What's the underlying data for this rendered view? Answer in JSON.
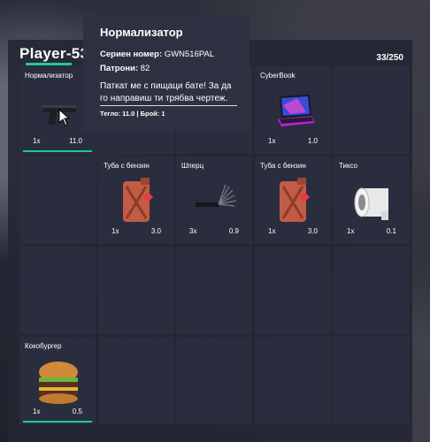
{
  "player": {
    "name": "Player-53",
    "capacity": "33/250"
  },
  "tooltip": {
    "title": "Нормализатор",
    "serial_label": "Сериен номер:",
    "serial_value": "GWN516PAL",
    "ammo_label": "Патрони:",
    "ammo_value": "82",
    "description": "Паткат ме с пищаци бате! За да го направиш ти трябва чертеж.",
    "footer": "Тегло: 11.0 | Брой: 1"
  },
  "slots": [
    {
      "label": "Нормализатор",
      "count": "1x",
      "weight": "11.0",
      "icon": "pistol-icon",
      "equipped": true
    },
    {
      "label": "",
      "count": "",
      "weight": "",
      "icon": "",
      "equipped": false
    },
    {
      "label": "",
      "count": "",
      "weight": "",
      "icon": "",
      "equipped": false
    },
    {
      "label": "CyberBook",
      "count": "1x",
      "weight": "1.0",
      "icon": "laptop-icon",
      "equipped": false
    },
    {
      "label": "",
      "count": "",
      "weight": "",
      "icon": "",
      "equipped": false
    },
    {
      "label": "",
      "count": "",
      "weight": "",
      "icon": "",
      "equipped": false
    },
    {
      "label": "Туба с бензин",
      "count": "1x",
      "weight": "3.0",
      "icon": "jerrycan-icon",
      "equipped": false
    },
    {
      "label": "Шперц",
      "count": "3x",
      "weight": "0.9",
      "icon": "lockpick-icon",
      "equipped": false
    },
    {
      "label": "Туба с бензин",
      "count": "1x",
      "weight": "3.0",
      "icon": "jerrycan-icon",
      "equipped": false
    },
    {
      "label": "Тиксо",
      "count": "1x",
      "weight": "0.1",
      "icon": "tape-icon",
      "equipped": false
    },
    {
      "label": "",
      "count": "",
      "weight": "",
      "icon": "",
      "equipped": false
    },
    {
      "label": "",
      "count": "",
      "weight": "",
      "icon": "",
      "equipped": false
    },
    {
      "label": "",
      "count": "",
      "weight": "",
      "icon": "",
      "equipped": false
    },
    {
      "label": "",
      "count": "",
      "weight": "",
      "icon": "",
      "equipped": false
    },
    {
      "label": "",
      "count": "",
      "weight": "",
      "icon": "",
      "equipped": false
    },
    {
      "label": "Кокобургер",
      "count": "1x",
      "weight": "0.5",
      "icon": "burger-icon",
      "equipped": true
    },
    {
      "label": "",
      "count": "",
      "weight": "",
      "icon": "",
      "equipped": false
    },
    {
      "label": "",
      "count": "",
      "weight": "",
      "icon": "",
      "equipped": false
    },
    {
      "label": "",
      "count": "",
      "weight": "",
      "icon": "",
      "equipped": false
    },
    {
      "label": "",
      "count": "",
      "weight": "",
      "icon": "",
      "equipped": false
    }
  ],
  "colors": {
    "accent": "#1ec9a3",
    "panel": "#242634",
    "slot": "#2a2d3d"
  }
}
